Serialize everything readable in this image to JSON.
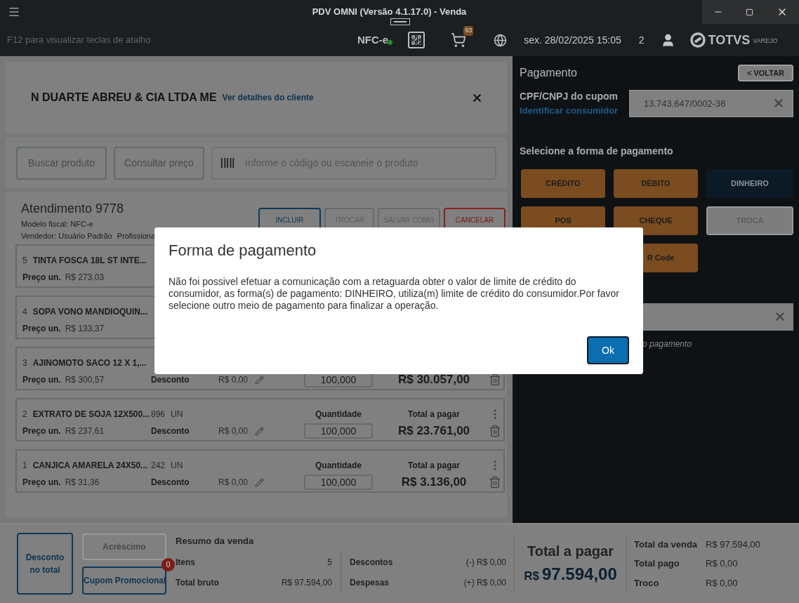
{
  "window": {
    "title": "PDV OMNI (Versão 4.1.17.0) - Venda"
  },
  "header": {
    "shortcut_hint": "F12 para visualizar teclas de atalho",
    "document_type": "NFC-e",
    "cart_badge": "93",
    "datetime": "sex. 28/02/2025 15:05",
    "count": "2",
    "logo": {
      "name": "TOTVS",
      "sub": "VAREJO"
    }
  },
  "customer": {
    "name": "N DUARTE ABREU & CIA LTDA ME",
    "link": "Ver detalhes do cliente"
  },
  "search": {
    "buttons": [
      "Buscar produto",
      "Consultar preço"
    ],
    "placeholder": "Informe o código ou escaneie o produto"
  },
  "attendance": {
    "title": "Atendimento 9778",
    "fiscal_model": "Modelo fiscal: NFC-e",
    "seller": "Vendedor: Usuário Padrão",
    "professional": "Profissiona",
    "actions": [
      {
        "label": "INCLUIR",
        "kind": "primary"
      },
      {
        "label": "TROCAR",
        "kind": "disabled"
      },
      {
        "label": "SALVAR COMO",
        "kind": "disabled"
      },
      {
        "label": "CANCELAR",
        "kind": "danger"
      }
    ]
  },
  "items": [
    {
      "number": "5",
      "name": "TINTA FOSCA 18L ST INTE...",
      "price_label": "Preço un.",
      "price": "R$ 273,03"
    },
    {
      "number": "4",
      "name": "SOPA VONO MANDIOQUIN...",
      "price_label": "Preço un.",
      "price": "R$ 133,37"
    },
    {
      "number": "3",
      "name": "AJINOMOTO SACO 12 X 1,...",
      "price_label": "Preço un.",
      "price": "R$ 300,57",
      "discount_label": "Desconto",
      "discount": "R$ 0,00",
      "quantity": "100,000",
      "total": "R$ 30.057,00"
    },
    {
      "number": "2",
      "name": "EXTRATO DE SOJA 12X500...",
      "stock": "896",
      "unit": "UN",
      "price_label": "Preço un.",
      "price": "R$ 237,61",
      "discount_label": "Desconto",
      "discount": "R$ 0,00",
      "quantity_label": "Quantidade",
      "quantity": "100,000",
      "total_label": "Total a pagar",
      "total": "R$ 23.761,00"
    },
    {
      "number": "1",
      "name": "CANJICA AMARELA 24X50...",
      "stock": "242",
      "unit": "UN",
      "price_label": "Preço un.",
      "price": "R$ 31,36",
      "discount_label": "Desconto",
      "discount": "R$ 0,00",
      "quantity_label": "Quantidade",
      "quantity": "100,000",
      "total_label": "Total a pagar",
      "total": "R$ 3.136,00"
    }
  ],
  "payment": {
    "title": "Pagamento",
    "back_button": "< VOLTAR",
    "document_label": "CPF/CNPJ do cupom",
    "identify_link": "Identificar consumidor",
    "document_value": "13.743.647/0002-36",
    "methods_title": "Selecione a forma de pagamento",
    "methods": [
      {
        "label": "CRÉDITO",
        "kind": "standard"
      },
      {
        "label": "DÉBITO",
        "kind": "standard"
      },
      {
        "label": "DINHEIRO",
        "kind": "dark"
      },
      {
        "label": "POS",
        "kind": "standard"
      },
      {
        "label": "CHEQUE",
        "kind": "standard"
      },
      {
        "label": "TROCA",
        "kind": "disabled"
      },
      {
        "label": "R Code",
        "kind": "standard"
      }
    ],
    "amount_hint": "o pagamento"
  },
  "footer": {
    "discount_button": "Desconto no total",
    "surcharge_button": "Acréscimo",
    "coupon_button": "Cupom Promocional",
    "coupon_badge": "0",
    "summary_title": "Resumo da venda",
    "summary": [
      {
        "label": "Itens",
        "value": "5"
      },
      {
        "label": "Total bruto",
        "value": "R$ 97.594,00"
      },
      {
        "label": "Descontos",
        "value": "(-) R$ 0,00"
      },
      {
        "label": "Despesas",
        "value": "(+) R$ 0,00"
      }
    ],
    "total_label": "Total a pagar",
    "total_currency": "R$",
    "total_value": "97.594,00",
    "totals": [
      {
        "label": "Total da venda",
        "value": "R$ 97.594,00"
      },
      {
        "label": "Total pago",
        "value": "R$ 0,00"
      },
      {
        "label": "Troco",
        "value": "R$ 0,00"
      }
    ]
  },
  "dialog": {
    "title": "Forma de pagamento",
    "message": "Não foi possivel efetuar a comunicação com a retaguarda obter o valor de limite de crédito do consumidor, as forma(s) de pagamento: DINHEIRO, utiliza(m) limite de crédito do consumidor.Por favor selecione outro meio de pagamento para finalizar a operação.",
    "button": "Ok"
  }
}
